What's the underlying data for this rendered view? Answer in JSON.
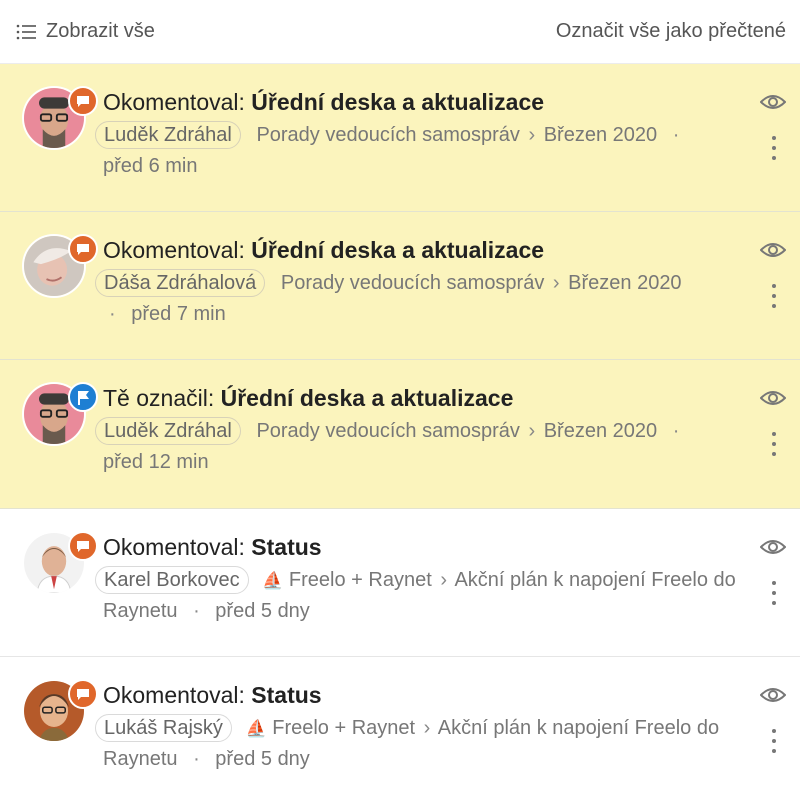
{
  "header": {
    "show_all_label": "Zobrazit vše",
    "mark_all_read_label": "Označit vše jako přečtené"
  },
  "colors": {
    "unread_bg": "#fbf4bd",
    "comment_badge": "#e0672b",
    "mention_badge": "#1e7fd3"
  },
  "notifications": [
    {
      "action": "Okomentoval:",
      "subject": "Úřední deska a aktualizace",
      "author": "Luděk Zdráhal",
      "path_1": "Porady vedoucích samospráv",
      "path_sep": "›",
      "path_2": "Březen 2020",
      "dot": "·",
      "time": "před 6 min",
      "badge": "comment-icon",
      "unread": true
    },
    {
      "action": "Okomentoval:",
      "subject": "Úřední deska a aktualizace",
      "author": "Dáša Zdráhalová",
      "path_1": "Porady vedoucích samospráv",
      "path_sep": "›",
      "path_2": "Březen 2020",
      "dot": "·",
      "time": "před 7 min",
      "badge": "comment-icon",
      "unread": true
    },
    {
      "action": "Tě označil:",
      "subject": "Úřední deska a aktualizace",
      "author": "Luděk Zdráhal",
      "path_1": "Porady vedoucích samospráv",
      "path_sep": "›",
      "path_2": "Březen 2020",
      "dot": "·",
      "time": "před 12 min",
      "badge": "flag-icon",
      "unread": true
    },
    {
      "action": "Okomentoval:",
      "subject": "Status",
      "author": "Karel Borkovec",
      "project_icon": "⛵",
      "path_1": "Freelo + Raynet",
      "path_sep": "›",
      "path_2": "Akční plán k napojení Freelo do Raynetu",
      "dot": "·",
      "time": "před 5 dny",
      "badge": "comment-icon",
      "unread": false
    },
    {
      "action": "Okomentoval:",
      "subject": "Status",
      "author": "Lukáš Rajský",
      "project_icon": "⛵",
      "path_1": "Freelo + Raynet",
      "path_sep": "›",
      "path_2": "Akční plán k napojení Freelo do Raynetu",
      "dot": "·",
      "time": "před 5 dny",
      "badge": "comment-icon",
      "unread": false
    }
  ]
}
